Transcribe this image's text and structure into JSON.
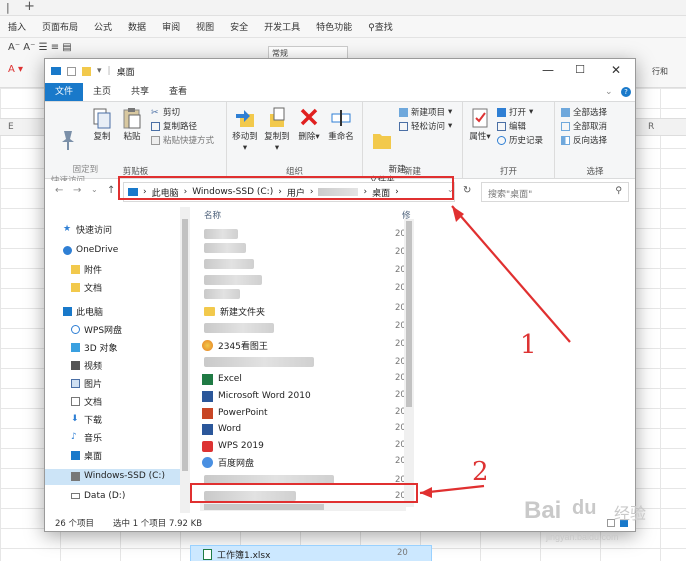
{
  "background": {
    "menu": [
      "插入",
      "页面布局",
      "公式",
      "数据",
      "审阅",
      "视图",
      "安全",
      "开发工具",
      "特色功能",
      "查找"
    ],
    "tool_normal": "常规",
    "tool_row_right": "行和",
    "col_letters": [
      "E",
      "R"
    ]
  },
  "window": {
    "title": "桌面",
    "ribbon_tabs": [
      "文件",
      "主页",
      "共享",
      "查看"
    ],
    "clipboard": {
      "pin": "固定到\n快速访问",
      "copy": "复制",
      "paste": "粘贴",
      "cut": "剪切",
      "copy_path": "复制路径",
      "paste_shortcut": "粘贴快捷方式",
      "label": "剪贴板"
    },
    "organize": {
      "move_to": "移动到",
      "copy_to": "复制到",
      "delete": "删除",
      "rename": "重命名",
      "label": "组织"
    },
    "new": {
      "new_folder": "新建\n文件夹",
      "new_item": "新建项目",
      "easy_access": "轻松访问",
      "label": "新建"
    },
    "open": {
      "properties": "属性",
      "open": "打开",
      "edit": "编辑",
      "history": "历史记录",
      "label": "打开"
    },
    "select": {
      "select_all": "全部选择",
      "select_none": "全部取消",
      "invert": "反向选择",
      "label": "选择"
    },
    "address": {
      "this_pc": "此电脑",
      "drive": "Windows-SSD (C:)",
      "users": "用户",
      "desktop": "桌面"
    },
    "search_placeholder": "搜索\"桌面\"",
    "nav_pane": [
      "快速访问",
      "OneDrive",
      "附件",
      "文档",
      "此电脑",
      "WPS网盘",
      "3D 对象",
      "视频",
      "图片",
      "文档",
      "下载",
      "音乐",
      "桌面",
      "Windows-SSD (C:)",
      "Data (D:)"
    ],
    "file_header_name": "名称",
    "file_header_date": "修",
    "files": {
      "new_folder": "新建文件夹",
      "viewer": "2345看图王",
      "excel": "Excel",
      "word2010": "Microsoft Word 2010",
      "powerpoint": "PowerPoint",
      "word": "Word",
      "wps": "WPS 2019",
      "baidu": "百度网盘",
      "selected": "工作簿1.xlsx"
    },
    "date_prefix": "20",
    "status": {
      "count": "26 个项目",
      "selected": "选中 1 个项目  7.92 KB"
    }
  },
  "annotations": {
    "one": "1",
    "two": "2"
  },
  "watermark": {
    "brand": "Bai",
    "brand2": "经验",
    "url": "jingyan.baidu.com"
  }
}
